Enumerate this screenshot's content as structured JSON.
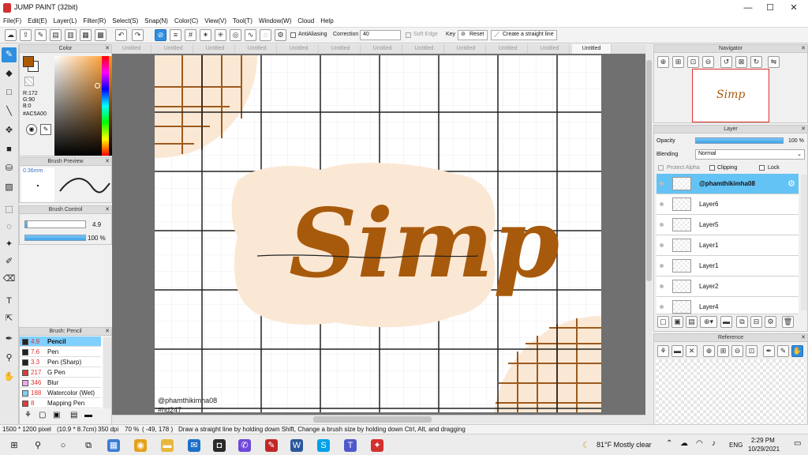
{
  "window": {
    "title": "JUMP PAINT (32bit)",
    "min": "—",
    "max": "☐",
    "close": "✕"
  },
  "menu": [
    "File(F)",
    "Edit(E)",
    "Layer(L)",
    "Filter(R)",
    "Select(S)",
    "Snap(N)",
    "Color(C)",
    "View(V)",
    "Tool(T)",
    "Window(W)",
    "Cloud",
    "Help"
  ],
  "toolbar": {
    "antialiasing": "AntiAliasing",
    "correction_label": "Correction",
    "correction_value": "40",
    "soft_edge": "Soft Edge",
    "key_label": "Key",
    "reset": "Reset",
    "straight_line": "Create a straight line"
  },
  "color_panel": {
    "title": "Color",
    "r": "R:172",
    "g": "G:90",
    "b": "B:0",
    "hex": "#AC5A00",
    "fg": "#ac5a00"
  },
  "brush_preview": {
    "title": "Brush Preview",
    "size": "0.36mm"
  },
  "brush_control": {
    "title": "Brush Control",
    "size_value": "4.9",
    "opacity_value": "100 %"
  },
  "brush_list": {
    "title": "Brush: Pencil",
    "items": [
      {
        "size": "4.9",
        "name": "Pencil",
        "color": "#222222"
      },
      {
        "size": "7.6",
        "name": "Pen",
        "color": "#222222"
      },
      {
        "size": "3.3",
        "name": "Pen (Sharp)",
        "color": "#222222"
      },
      {
        "size": "217",
        "name": "G Pen",
        "color": "#e03a3a"
      },
      {
        "size": "346",
        "name": "Blur",
        "color": "#f0a8e8"
      },
      {
        "size": "188",
        "name": "Watercolor (Wet)",
        "color": "#7fd0ff"
      },
      {
        "size": "8",
        "name": "Mapping Pen",
        "color": "#e03a3a"
      }
    ]
  },
  "tabs": [
    "Untitled",
    "Untitled",
    "Untitled",
    "Untitled",
    "Untitled",
    "Untitled",
    "Untitled",
    "Untitled",
    "Untitled",
    "Untitled",
    "Untitled",
    "Untitled"
  ],
  "canvas": {
    "lettering": "Simp",
    "credit_line1": "@phamthikimha08",
    "credit_line2": "#hd247",
    "brand": "#a85a0c"
  },
  "navigator": {
    "title": "Navigator"
  },
  "layer_panel": {
    "title": "Layer",
    "opacity_label": "Opacity",
    "opacity_value": "100 %",
    "blending_label": "Blending",
    "blending_value": "Normal",
    "protect_alpha": "Protect Alpha",
    "clipping": "Clipping",
    "lock": "Lock",
    "layers": [
      "@phamthikimha08",
      "Layer6",
      "Layer5",
      "Layer1",
      "Layer1",
      "Layer2",
      "Layer4"
    ]
  },
  "reference": {
    "title": "Reference"
  },
  "status": {
    "pixels": "1500 * 1200 pixel",
    "cm": "(10.9 * 8.7cm)",
    "dpi": "350 dpi",
    "zoom": "70 %",
    "coords": "( -49, 178 )",
    "hint": "Draw a straight line by holding down Shift, Change a brush size by holding down Ctrl, Alt, and dragging"
  },
  "taskbar": {
    "weather": "81°F  Mostly clear",
    "lang": "ENG",
    "time": "2:29 PM",
    "date": "10/29/2021"
  }
}
